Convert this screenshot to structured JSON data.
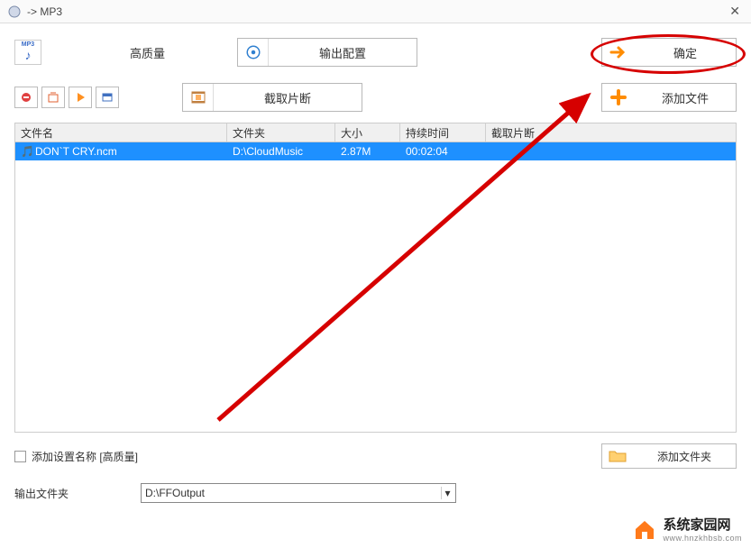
{
  "window": {
    "title": " -> MP3"
  },
  "toprow": {
    "mp3_label": "MP3",
    "quality_label": "高质量",
    "output_config_label": "输出配置",
    "ok_label": "确定"
  },
  "toolbar": {
    "trim_label": "截取片断",
    "add_file_label": "添加文件"
  },
  "table": {
    "headers": {
      "name": "文件名",
      "folder": "文件夹",
      "size": "大小",
      "duration": "持续时间",
      "trim": "截取片断"
    },
    "rows": [
      {
        "icon": "🎵",
        "name": "DON`T CRY.ncm",
        "folder": "D:\\CloudMusic",
        "size": "2.87M",
        "duration": "00:02:04",
        "selected": true
      }
    ]
  },
  "bottom": {
    "save_cfg_label": "添加设置名称  [高质量]",
    "add_folder_label": "添加文件夹",
    "output_folder_label": "输出文件夹",
    "output_folder_value": "D:\\FFOutput"
  },
  "watermark": {
    "cn": "系统家园网",
    "domain": "www.hnzkhbsb.com"
  }
}
